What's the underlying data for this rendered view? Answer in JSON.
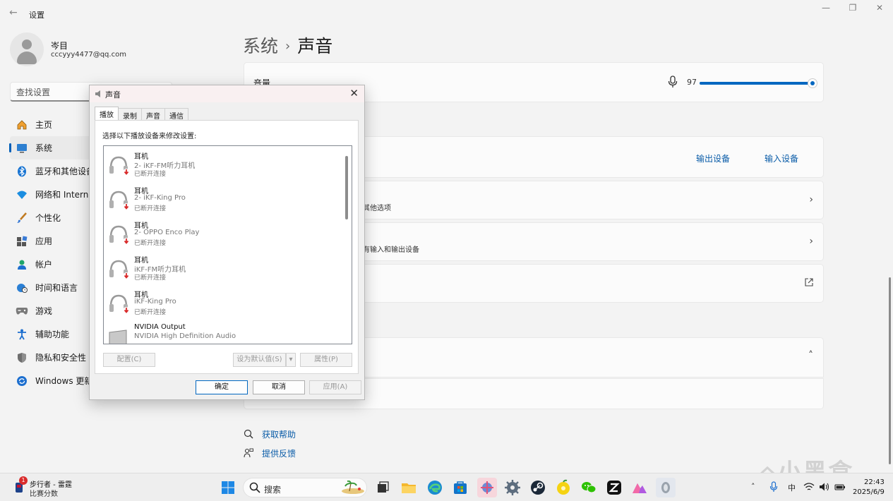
{
  "window": {
    "title": "设置",
    "minimize": "—",
    "maximize": "❐",
    "close": "✕"
  },
  "profile": {
    "name": "岑目",
    "email": "cccyyy4477@qq.com"
  },
  "search": {
    "placeholder": "查找设置"
  },
  "sidebar": {
    "items": [
      {
        "label": "主页",
        "icon": "home-icon"
      },
      {
        "label": "系统",
        "icon": "system-icon"
      },
      {
        "label": "蓝牙和其他设备",
        "icon": "bluetooth-icon"
      },
      {
        "label": "网络和 Internet",
        "icon": "wifi-icon"
      },
      {
        "label": "个性化",
        "icon": "brush-icon"
      },
      {
        "label": "应用",
        "icon": "apps-icon"
      },
      {
        "label": "帐户",
        "icon": "account-icon"
      },
      {
        "label": "时间和语言",
        "icon": "globe-clock-icon"
      },
      {
        "label": "游戏",
        "icon": "gamepad-icon"
      },
      {
        "label": "辅助功能",
        "icon": "accessibility-icon"
      },
      {
        "label": "隐私和安全性",
        "icon": "shield-icon"
      },
      {
        "label": "Windows 更新",
        "icon": "update-icon"
      }
    ]
  },
  "page": {
    "breadcrumb_parent": "系统",
    "breadcrumb_sep": "›",
    "title": "声音"
  },
  "volume": {
    "label": "音量",
    "value": "97",
    "level": 0.97
  },
  "io_links": {
    "output": "输出设备",
    "input": "输入设备"
  },
  "cards": {
    "row1_sub": "其他选项",
    "row2_sub": "有输入和输出设备"
  },
  "help": {
    "get_help": "获取帮助",
    "feedback": "提供反馈"
  },
  "dialog": {
    "title": "声音",
    "tabs": [
      "播放",
      "录制",
      "声音",
      "通信"
    ],
    "instruction": "选择以下播放设备来修改设置:",
    "devices": [
      {
        "name": "耳机",
        "desc": "2- iKF-FM听力耳机",
        "status": "已断开连接",
        "icon": "headphones-icon"
      },
      {
        "name": "耳机",
        "desc": "2- iKF-King Pro",
        "status": "已断开连接",
        "icon": "headphones-icon"
      },
      {
        "name": "耳机",
        "desc": "2- OPPO Enco Play",
        "status": "已断开连接",
        "icon": "headphones-icon"
      },
      {
        "name": "耳机",
        "desc": "iKF-FM听力耳机",
        "status": "已断开连接",
        "icon": "headphones-icon"
      },
      {
        "name": "耳机",
        "desc": "iKF-King Pro",
        "status": "已断开连接",
        "icon": "headphones-icon"
      },
      {
        "name": "NVIDIA Output",
        "desc": "NVIDIA High Definition Audio",
        "status": "",
        "icon": "monitor-icon"
      }
    ],
    "buttons": {
      "configure": "配置(C)",
      "set_default": "设为默认值(S)",
      "properties": "属性(P)",
      "ok": "确定",
      "cancel": "取消",
      "apply": "应用(A)"
    }
  },
  "taskbar": {
    "weather_badge": "1",
    "weather_title": "步行者 - 雷霆",
    "weather_sub": "比赛分数",
    "search_label": "搜索",
    "ime": "中",
    "time": "22:43",
    "date": "2025/6/9"
  },
  "watermark": "小黑盒",
  "colors": {
    "accent": "#0067c0",
    "link": "#0a5ca8",
    "error": "#d92b2b"
  }
}
